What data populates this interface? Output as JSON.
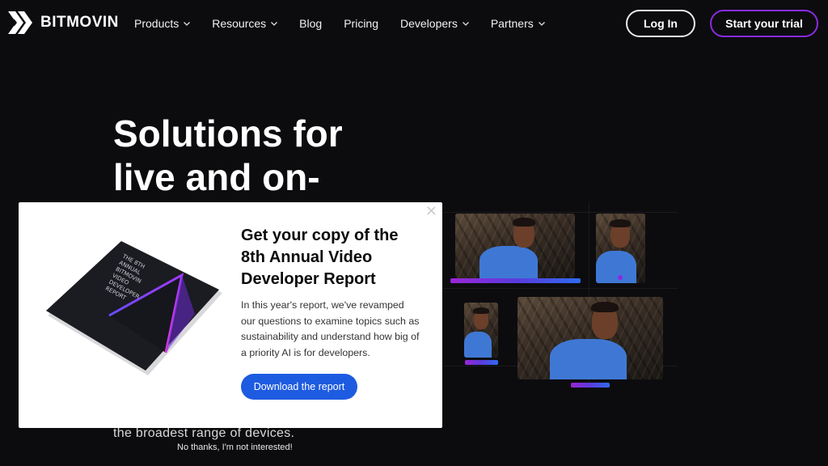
{
  "brand": {
    "name": "BITMOVIN"
  },
  "nav": {
    "items": [
      {
        "label": "Products",
        "has_dropdown": true
      },
      {
        "label": "Resources",
        "has_dropdown": true
      },
      {
        "label": "Blog",
        "has_dropdown": false
      },
      {
        "label": "Pricing",
        "has_dropdown": false
      },
      {
        "label": "Developers",
        "has_dropdown": true
      },
      {
        "label": "Partners",
        "has_dropdown": true
      }
    ],
    "login_label": "Log In",
    "trial_label": "Start your trial"
  },
  "hero": {
    "title": "Solutions for live and on-",
    "subtitle": "the broadest range of devices."
  },
  "modal": {
    "title": "Get your copy of the 8th Annual Video Developer Report",
    "body": "In this year's report, we've revamped our questions to examine topics such as sustainability and understand how big of a priority AI is for developers.",
    "button_label": "Download the report",
    "close_glyph": "×",
    "book_cover_text": "THE 8TH ANNUAL BITMOVIN VIDEO DEVELOPER REPORT",
    "dismiss_label": "No thanks, I'm not interested!"
  },
  "colors": {
    "background": "#0c0c0f",
    "accent_purple": "#8a2be2",
    "accent_blue": "#1d5be0",
    "shirt_blue": "#3f78d4"
  },
  "icons": {
    "logo": "bitmovin-chevrons-icon",
    "dropdown": "chevron-down-icon",
    "close": "close-icon"
  }
}
